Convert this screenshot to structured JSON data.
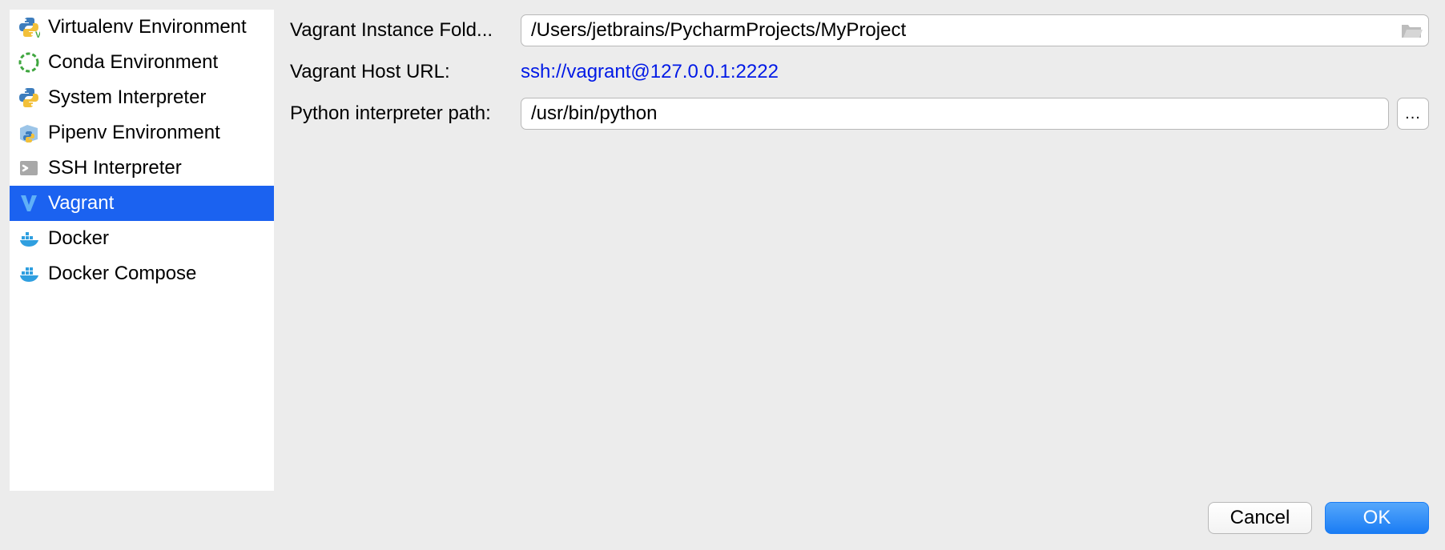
{
  "sidebar": {
    "items": [
      {
        "label": "Virtualenv Environment",
        "icon": "python-venv-icon"
      },
      {
        "label": "Conda Environment",
        "icon": "conda-icon"
      },
      {
        "label": "System Interpreter",
        "icon": "python-icon"
      },
      {
        "label": "Pipenv Environment",
        "icon": "pipenv-icon"
      },
      {
        "label": "SSH Interpreter",
        "icon": "ssh-icon"
      },
      {
        "label": "Vagrant",
        "icon": "vagrant-icon"
      },
      {
        "label": "Docker",
        "icon": "docker-icon"
      },
      {
        "label": "Docker Compose",
        "icon": "docker-compose-icon"
      }
    ],
    "selected_index": 5
  },
  "form": {
    "instance_folder_label": "Vagrant Instance Fold...",
    "instance_folder_value": "/Users/jetbrains/PycharmProjects/MyProject",
    "host_url_label": "Vagrant Host URL:",
    "host_url_value": "ssh://vagrant@127.0.0.1:2222",
    "interpreter_path_label": "Python interpreter path:",
    "interpreter_path_value": "/usr/bin/python",
    "browse_ellipsis": "..."
  },
  "buttons": {
    "cancel": "Cancel",
    "ok": "OK"
  }
}
